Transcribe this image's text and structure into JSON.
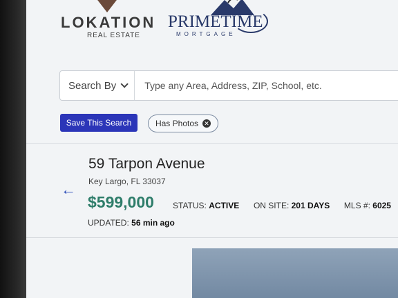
{
  "header": {
    "brand_left": "LOKATION",
    "brand_left_sub": "REAL ESTATE",
    "brand_right": "PRIMETIME",
    "brand_right_sub": "MORTGAGE"
  },
  "search": {
    "search_by_label": "Search By",
    "placeholder": "Type any Area, Address, ZIP, School, etc."
  },
  "actions": {
    "save_search_label": "Save This Search",
    "filter_chip_label": "Has Photos",
    "chip_remove_glyph": "✕"
  },
  "listing": {
    "address": "59 Tarpon Avenue",
    "city_state_zip": "Key Largo, FL 33037",
    "price": "$599,000",
    "status_label": "STATUS:",
    "status_value": "ACTIVE",
    "onsite_label": "ON SITE:",
    "onsite_value": "201 DAYS",
    "mls_label": "MLS #:",
    "mls_value": "6025",
    "updated_label": "UPDATED:",
    "updated_value": "56 min ago"
  },
  "icons": {
    "back": "arrow-left-icon",
    "chevron": "chevron-down-icon",
    "remove": "close-circle-icon"
  },
  "colors": {
    "primary_button": "#2b35b8",
    "price": "#2e7d6a",
    "back_arrow": "#2b4bb8"
  }
}
